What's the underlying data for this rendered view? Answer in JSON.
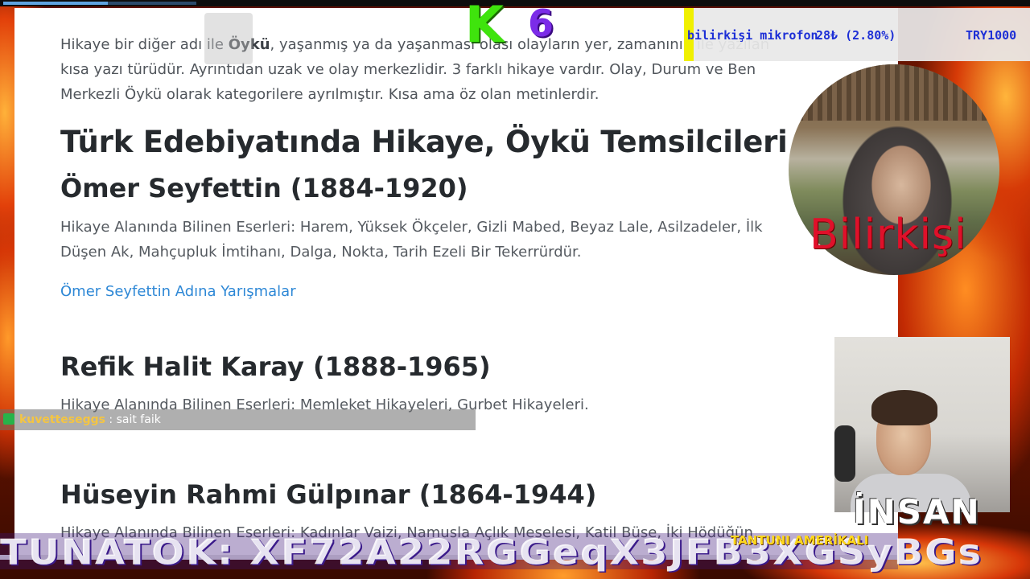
{
  "article": {
    "intro_before_bold": "Hikaye bir diğer adı ile ",
    "intro_bold": "Öykü",
    "intro_after_bold": ", yaşanmış ya da yaşanması olası olayların yer, zamanının ile yazılan kısa yazı türüdür. Ayrıntıdan uzak ve olay merkezlidir. 3 farklı hikaye vardır. Olay, Durum ve Ben Merkezli Öykü olarak kategorilere ayrılmıştır. Kısa ama öz olan metinlerdir.",
    "section_title": "Türk Edebiyatında Hikaye, Öykü Temsilcileri",
    "authors": [
      {
        "heading": "Ömer Seyfettin (1884-1920)",
        "works": "Hikaye Alanında Bilinen Eserleri: Harem, Yüksek Ökçeler, Gizli Mabed, Beyaz Lale, Asilzadeler, İlk Düşen Ak, Mahçupluk İmtihanı, Dalga, Nokta, Tarih Ezeli Bir Tekerrürdür.",
        "link": "Ömer Seyfettin Adına Yarışmalar"
      },
      {
        "heading": "Refik Halit Karay (1888-1965)",
        "works": "Hikaye Alanında Bilinen Eserleri: Memleket Hikayeleri, Gurbet Hikayeleri."
      },
      {
        "heading": "Hüseyin Rahmi Gülpınar (1864-1944)",
        "works": "Hikaye Alanında Bilinen Eserleri: Kadınlar Vaizi, Namusla Açlık Meselesi, Katil Büse, İki Hödüğün"
      }
    ]
  },
  "overlays": {
    "ticker_item": "bilirkişi mikrofon",
    "ticker_amount": "28₺ (2.80%)",
    "ticker_goal": "TRY1000",
    "logo_letter": "K",
    "logo_digit": "6",
    "cam1_label": "Bilirkişi",
    "cam2_label": "İNSAN",
    "chat_user": "kuvetteseggs",
    "chat_sep": " : ",
    "chat_message": "sait faik",
    "banner_text": "TUNATOK: XF72A22RGGeqX3JFB3XGSyBGs",
    "banner_sub": "TANTUNI AMERİKALI"
  },
  "colors": {
    "link": "#2e88d6",
    "heading": "#262a2e",
    "ticker_text": "#1d2fd6",
    "logo_green": "#3fe40d",
    "logo_purple": "#7b2ce8",
    "cam1_label": "#e0102a"
  }
}
